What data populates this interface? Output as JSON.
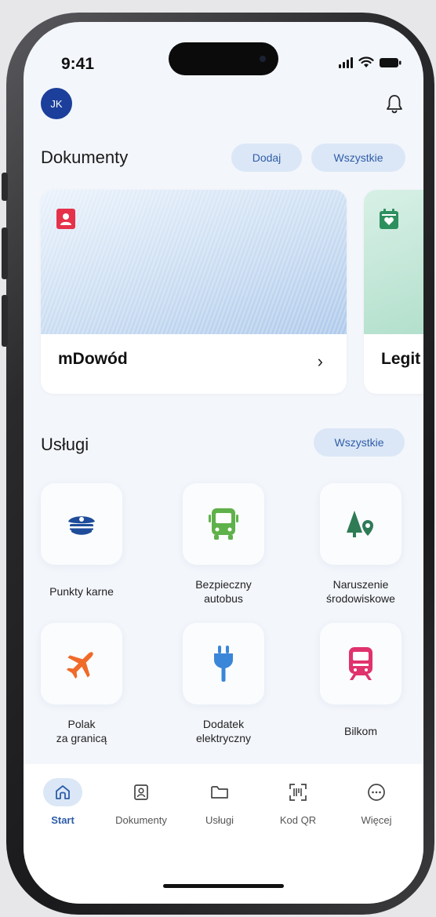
{
  "status": {
    "time": "9:41"
  },
  "header": {
    "avatar_initials": "JK"
  },
  "documents": {
    "title": "Dokumenty",
    "add_label": "Dodaj",
    "all_label": "Wszystkie",
    "cards": [
      {
        "name": "mDowód",
        "icon": "id-card-icon",
        "color": "#e5314a"
      },
      {
        "name": "Legit",
        "icon": "calendar-heart-icon",
        "color": "#2e8f5e"
      }
    ]
  },
  "services": {
    "title": "Usługi",
    "all_label": "Wszystkie",
    "items": [
      {
        "line1": "Punkty karne",
        "line2": "",
        "icon": "police-cap-icon"
      },
      {
        "line1": "Bezpieczny",
        "line2": "autobus",
        "icon": "bus-icon"
      },
      {
        "line1": "Naruszenie",
        "line2": "środowiskowe",
        "icon": "tree-location-icon"
      },
      {
        "line1": "Polak",
        "line2": "za granicą",
        "icon": "airplane-icon"
      },
      {
        "line1": "Dodatek",
        "line2": "elektryczny",
        "icon": "plug-icon"
      },
      {
        "line1": "Bilkom",
        "line2": "",
        "icon": "train-icon"
      }
    ]
  },
  "tabbar": {
    "tabs": [
      {
        "label": "Start",
        "icon": "home-icon",
        "active": true
      },
      {
        "label": "Dokumenty",
        "icon": "documents-icon"
      },
      {
        "label": "Usługi",
        "icon": "folder-icon"
      },
      {
        "label": "Kod QR",
        "icon": "qr-scan-icon"
      },
      {
        "label": "Więcej",
        "icon": "more-icon"
      }
    ]
  },
  "colors": {
    "accent": "#2f5da8",
    "pill_bg": "#dbe7f6",
    "bus_green": "#5fb14a",
    "plane_orange": "#f06a2a",
    "plug_blue": "#3a86d8",
    "train_pink": "#e0326c",
    "cap_navy": "#1f4c9a"
  }
}
